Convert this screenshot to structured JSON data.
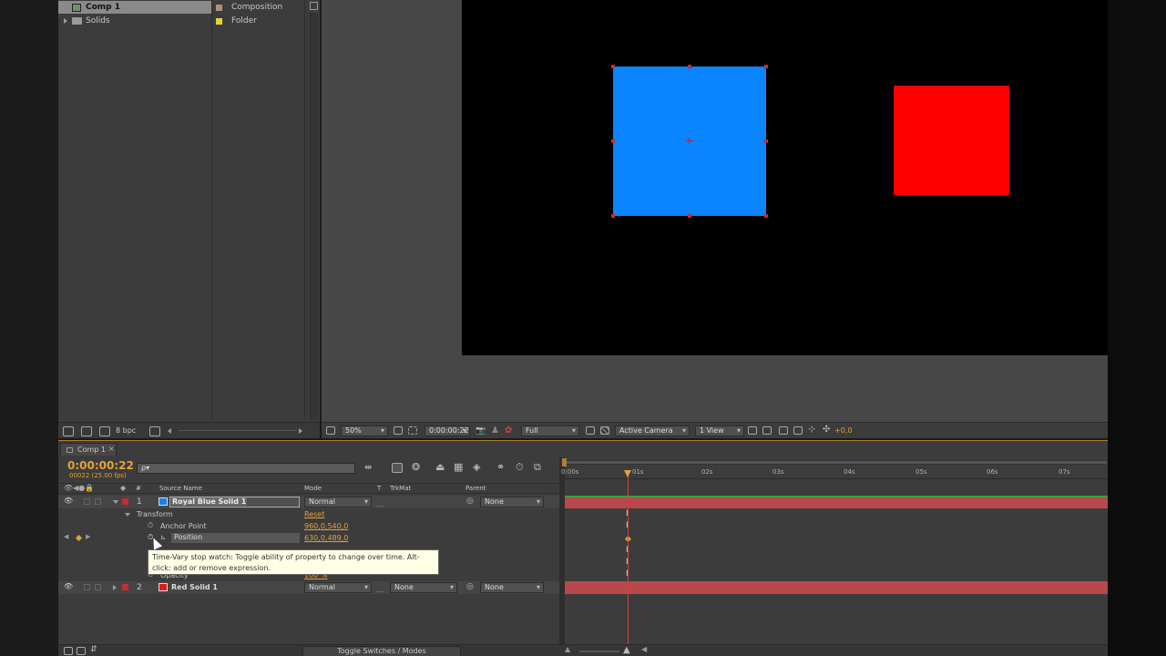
{
  "project": {
    "items": [
      {
        "name": "Comp 1",
        "type": "Composition",
        "label_color": "#b08f7a",
        "selected": true
      },
      {
        "name": "Solids",
        "type": "Folder",
        "label_color": "#e6d33c",
        "selected": false
      }
    ],
    "bpc": "8 bpc"
  },
  "viewer": {
    "zoom": "50%",
    "timecode": "0:00:00:22",
    "resolution": "Full",
    "camera": "Active Camera",
    "view_layout": "1 View",
    "exposure": "+0,0",
    "blue_color": "#0a84ff",
    "red_color": "#ff0000"
  },
  "timeline": {
    "tab": "Comp 1",
    "current_time": "0:00:00:22",
    "frame_info": "00022 (25.00 fps)",
    "search_placeholder": "ρ▾",
    "columns": {
      "num": "#",
      "source_name": "Source Name",
      "mode": "Mode",
      "t": "T",
      "trkmat": "TrkMat",
      "parent": "Parent"
    },
    "ruler": [
      "0:00s",
      "01s",
      "02s",
      "03s",
      "04s",
      "05s",
      "06s",
      "07s"
    ],
    "layers": [
      {
        "num": "1",
        "name": "Royal Blue Solid 1",
        "color": "#1a7fe8",
        "mode": "Normal",
        "trkmat": "",
        "parent": "None"
      },
      {
        "num": "2",
        "name": "Red Solid 1",
        "color": "#e01818",
        "mode": "Normal",
        "trkmat": "None",
        "parent": "None"
      }
    ],
    "transform": {
      "label": "Transform",
      "reset": "Reset",
      "anchor_label": "Anchor Point",
      "anchor_value": "960,0,540,0",
      "position_label": "Position",
      "position_value": "630,0,489,0",
      "opacity_label": "Opacity",
      "opacity_value": "100 %"
    },
    "tooltip": "Time-Vary stop watch: Toggle ability of property to change over time. Alt-click: add or remove expression.",
    "toggle_label": "Toggle Switches / Modes"
  }
}
